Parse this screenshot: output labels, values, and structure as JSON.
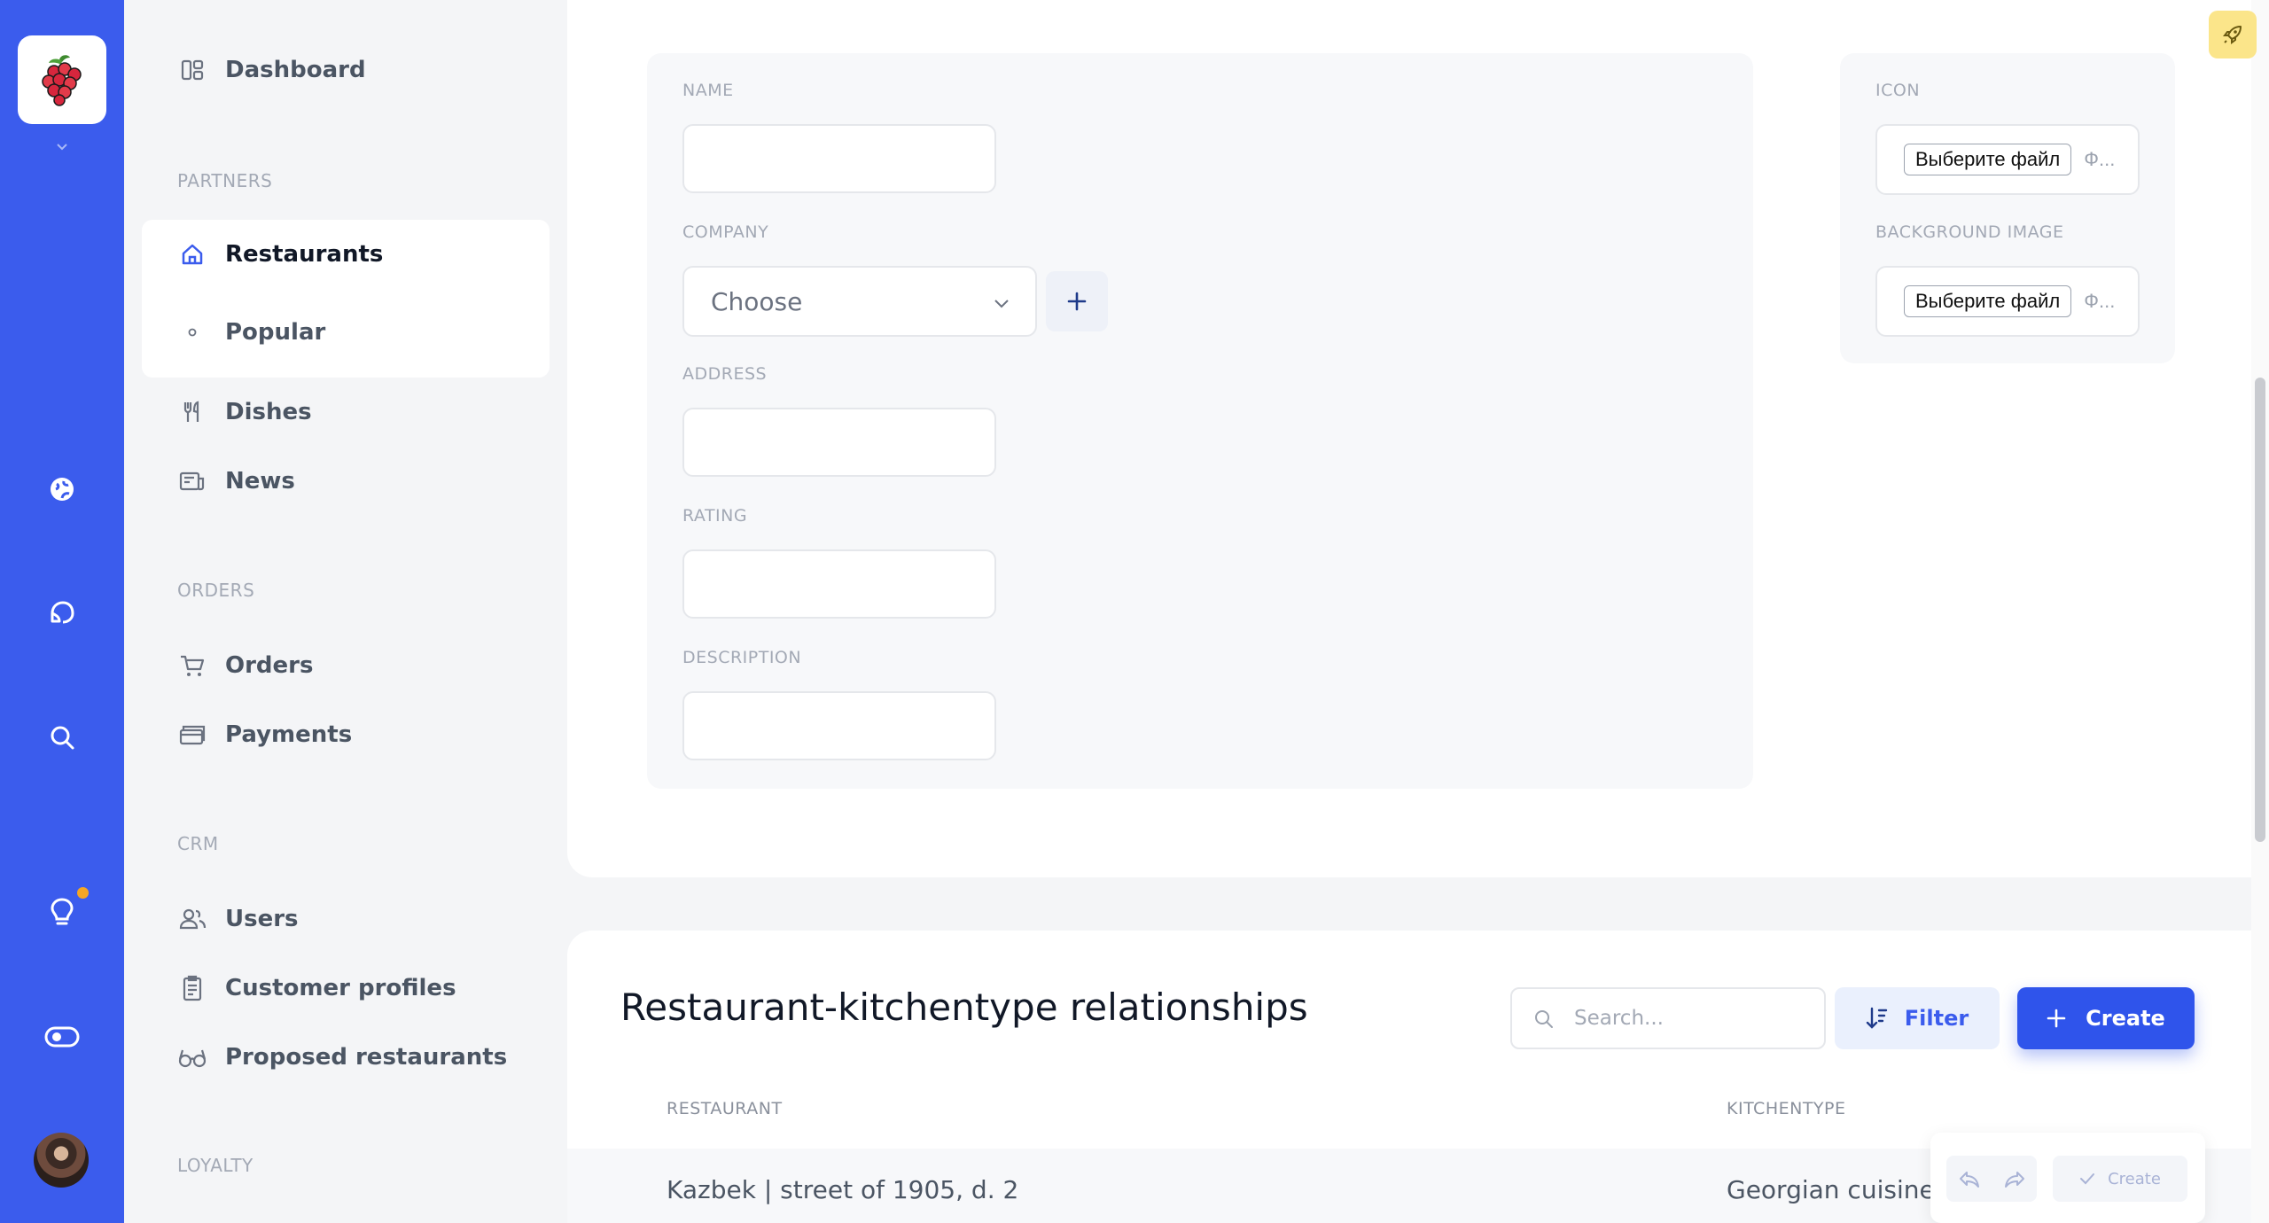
{
  "rail": {
    "icons": [
      "globe-icon",
      "chat-icon",
      "search-icon",
      "lightbulb-icon",
      "toggle-icon"
    ],
    "accent": "#3b5ced",
    "notification_color": "#f5a623"
  },
  "sidebar": {
    "dashboard": "Dashboard",
    "sections": {
      "partners": "PARTNERS",
      "orders": "ORDERS",
      "crm": "CRM",
      "loyalty": "LOYALTY"
    },
    "items": {
      "restaurants": "Restaurants",
      "popular": "Popular",
      "dishes": "Dishes",
      "news": "News",
      "orders": "Orders",
      "payments": "Payments",
      "users": "Users",
      "customer_profiles": "Customer profiles",
      "proposed_restaurants": "Proposed restaurants"
    }
  },
  "form": {
    "name_label": "NAME",
    "company_label": "COMPANY",
    "company_value": "Choose",
    "address_label": "ADDRESS",
    "rating_label": "RATING",
    "description_label": "DESCRIPTION",
    "icon_label": "ICON",
    "background_label": "BACKGROUND IMAGE",
    "file_button": "Выберите файл",
    "file_status": "Ф..."
  },
  "relationships": {
    "title": "Restaurant-kitchentype relationships",
    "search_placeholder": "Search...",
    "filter_label": "Filter",
    "create_label": "Create",
    "columns": [
      "RESTAURANT",
      "KITCHENTYPE"
    ],
    "rows": [
      {
        "restaurant": "Kazbek | street of 1905, d. 2",
        "kitchentype": "Georgian cuisine"
      }
    ]
  },
  "toolbar": {
    "create_label": "Create"
  }
}
